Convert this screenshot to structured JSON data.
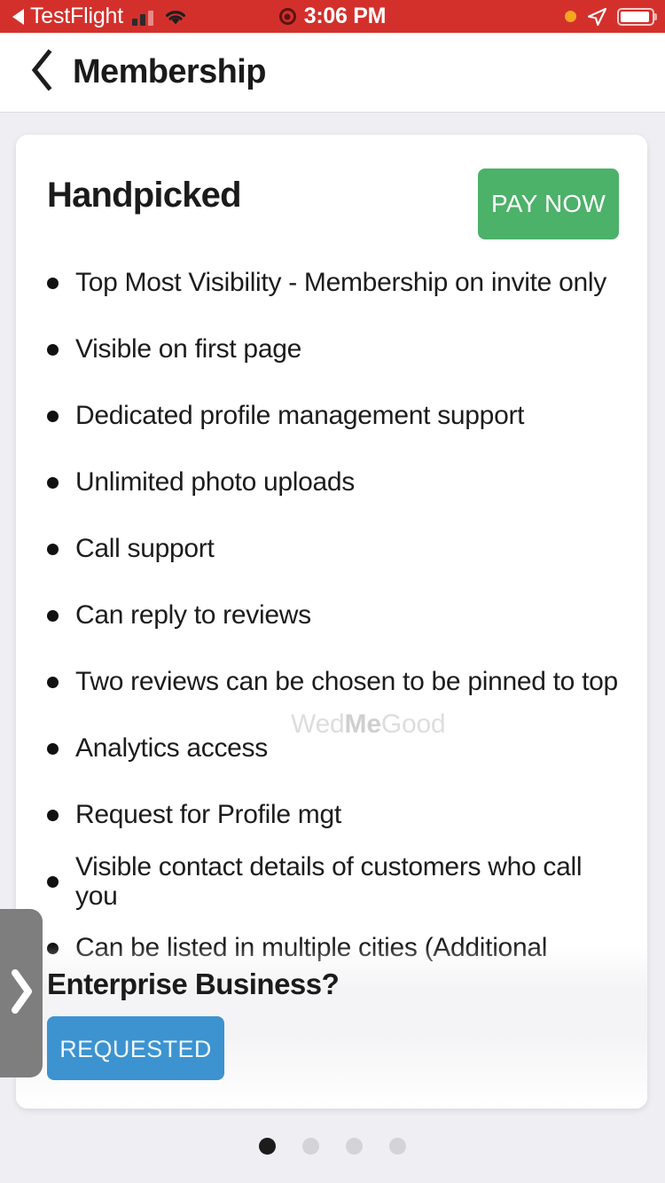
{
  "status_bar": {
    "back_indicator": "back-triangle",
    "carrier_app": "TestFlight",
    "signal_icon": "cellular-signal-icon",
    "wifi_icon": "wifi-icon",
    "recording_icon": "screen-recording-icon",
    "time": "3:06 PM",
    "orange_dot_icon": "microphone-in-use-indicator",
    "location_icon": "location-arrow-icon",
    "battery_icon": "battery-icon",
    "battery_fill_percent": 88,
    "background_color": "#d3302c"
  },
  "nav_bar": {
    "back_icon": "chevron-left-icon",
    "title": "Membership"
  },
  "plan_card": {
    "title": "Handpicked",
    "pay_button_label": "PAY NOW",
    "pay_button_color": "#4cb169",
    "watermark": {
      "prefix": "Wed",
      "emphasis": "Me",
      "suffix": "Good"
    },
    "features": [
      "Top Most Visibility - Membership on invite only",
      "Visible on first page",
      "Dedicated profile management support",
      "Unlimited photo uploads",
      "Call support",
      "Can reply to reviews",
      "Two reviews can be chosen to be pinned to top",
      "Analytics access",
      "Request for Profile mgt",
      "Visible contact details of customers who call you",
      "Can be listed in multiple cities (Additional"
    ],
    "enterprise": {
      "title": "Enterprise Business?",
      "button_label": "REQUESTED",
      "button_color": "#3c93d0"
    }
  },
  "side_tab": {
    "icon": "chevron-right-icon"
  },
  "pager": {
    "total": 4,
    "active_index": 0
  }
}
